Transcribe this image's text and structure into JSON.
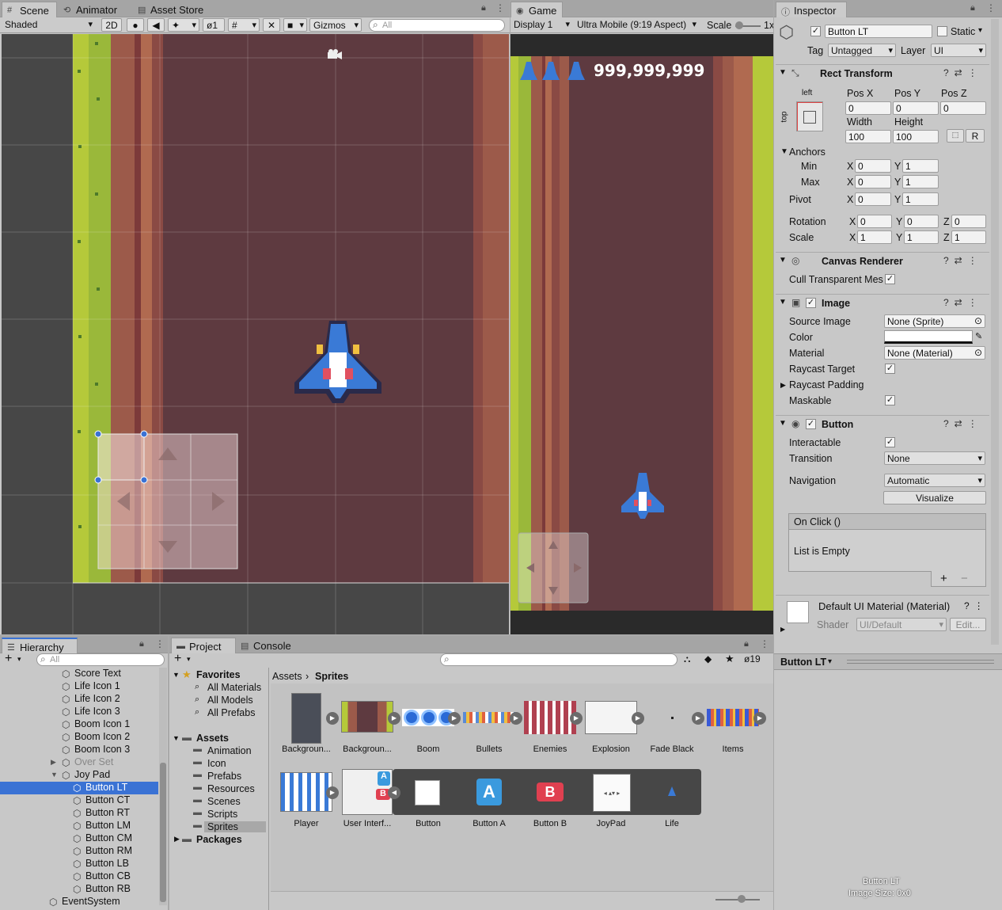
{
  "scene": {
    "tabs": [
      "Scene",
      "Animator",
      "Asset Store"
    ],
    "shading": "Shaded",
    "mode_2d": "2D",
    "hidden_count": "1",
    "gizmos": "Gizmos",
    "search_placeholder": "All"
  },
  "game": {
    "tab": "Game",
    "display": "Display 1",
    "aspect": "Ultra Mobile (9:19 Aspect)",
    "scale_label": "Scale",
    "scale_value": "1x",
    "score": "999,999,999"
  },
  "inspector": {
    "tab": "Inspector",
    "object_name": "Button LT",
    "static_label": "Static",
    "tag_label": "Tag",
    "tag_value": "Untagged",
    "layer_label": "Layer",
    "layer_value": "UI",
    "rect_transform": {
      "title": "Rect Transform",
      "anchor_h": "left",
      "anchor_v": "top",
      "pos_x_label": "Pos X",
      "pos_x": "0",
      "pos_y_label": "Pos Y",
      "pos_y": "0",
      "pos_z_label": "Pos Z",
      "pos_z": "0",
      "width_label": "Width",
      "width": "100",
      "height_label": "Height",
      "height": "100",
      "r_button": "R",
      "anchors_label": "Anchors",
      "min_label": "Min",
      "min_x": "0",
      "min_y": "1",
      "max_label": "Max",
      "max_x": "0",
      "max_y": "1",
      "pivot_label": "Pivot",
      "pivot_x": "0",
      "pivot_y": "1",
      "rotation_label": "Rotation",
      "rot_x": "0",
      "rot_y": "0",
      "rot_z": "0",
      "scale_label": "Scale",
      "scale_x": "1",
      "scale_y": "1",
      "scale_z": "1",
      "x": "X",
      "y": "Y",
      "z": "Z"
    },
    "canvas_renderer": {
      "title": "Canvas Renderer",
      "cull_label": "Cull Transparent Mes",
      "cull": true
    },
    "image": {
      "title": "Image",
      "source_label": "Source Image",
      "source_value": "None (Sprite)",
      "color_label": "Color",
      "material_label": "Material",
      "material_value": "None (Material)",
      "raycast_label": "Raycast Target",
      "padding_label": "Raycast Padding",
      "maskable_label": "Maskable"
    },
    "button": {
      "title": "Button",
      "interactable_label": "Interactable",
      "transition_label": "Transition",
      "transition_value": "None",
      "navigation_label": "Navigation",
      "navigation_value": "Automatic",
      "visualize": "Visualize",
      "onclick": "On Click ()",
      "list_empty": "List is Empty",
      "plus": "+",
      "minus": "−"
    },
    "material": {
      "name": "Default UI Material (Material)",
      "shader_label": "Shader",
      "shader_value": "UI/Default",
      "edit": "Edit..."
    },
    "preview": {
      "header": "Button LT",
      "caption_name": "Button LT",
      "caption_size": "Image Size: 0x0"
    }
  },
  "hierarchy": {
    "tab": "Hierarchy",
    "search_placeholder": "All",
    "items": [
      {
        "label": "Score Text",
        "indent": 2
      },
      {
        "label": "Life Icon 1",
        "indent": 2
      },
      {
        "label": "Life Icon 2",
        "indent": 2
      },
      {
        "label": "Life Icon 3",
        "indent": 2
      },
      {
        "label": "Boom Icon 1",
        "indent": 2
      },
      {
        "label": "Boom Icon 2",
        "indent": 2
      },
      {
        "label": "Boom Icon 3",
        "indent": 2
      },
      {
        "label": "Over Set",
        "indent": 2
      },
      {
        "label": "Joy Pad",
        "indent": 2
      },
      {
        "label": "Button LT",
        "indent": 3
      },
      {
        "label": "Button CT",
        "indent": 3
      },
      {
        "label": "Button RT",
        "indent": 3
      },
      {
        "label": "Button LM",
        "indent": 3
      },
      {
        "label": "Button CM",
        "indent": 3
      },
      {
        "label": "Button RM",
        "indent": 3
      },
      {
        "label": "Button LB",
        "indent": 3
      },
      {
        "label": "Button CB",
        "indent": 3
      },
      {
        "label": "Button RB",
        "indent": 3
      },
      {
        "label": "EventSystem",
        "indent": 1
      }
    ]
  },
  "project": {
    "tabs": [
      "Project",
      "Console"
    ],
    "hidden_count": "19",
    "favorites": "Favorites",
    "fav_items": [
      "All Materials",
      "All Models",
      "All Prefabs"
    ],
    "assets": "Assets",
    "folders": [
      "Animation",
      "Icon",
      "Prefabs",
      "Resources",
      "Scenes",
      "Scripts",
      "Sprites"
    ],
    "packages": "Packages",
    "breadcrumb_root": "Assets",
    "breadcrumb_current": "Sprites",
    "row1": [
      "Backgroun...",
      "Backgroun...",
      "Boom",
      "Bullets",
      "Enemies",
      "Explosion",
      "Fade Black",
      "Items"
    ],
    "row2": [
      "Player",
      "User Interf...",
      "Button",
      "Button A",
      "Button B",
      "JoyPad",
      "Life"
    ]
  },
  "colors": {
    "road": "#5e3a40",
    "grass": "#b5c93a",
    "dirt": "#9c5a4a",
    "ship_blue": "#3a7ad6",
    "selection": "#3a72d4"
  }
}
